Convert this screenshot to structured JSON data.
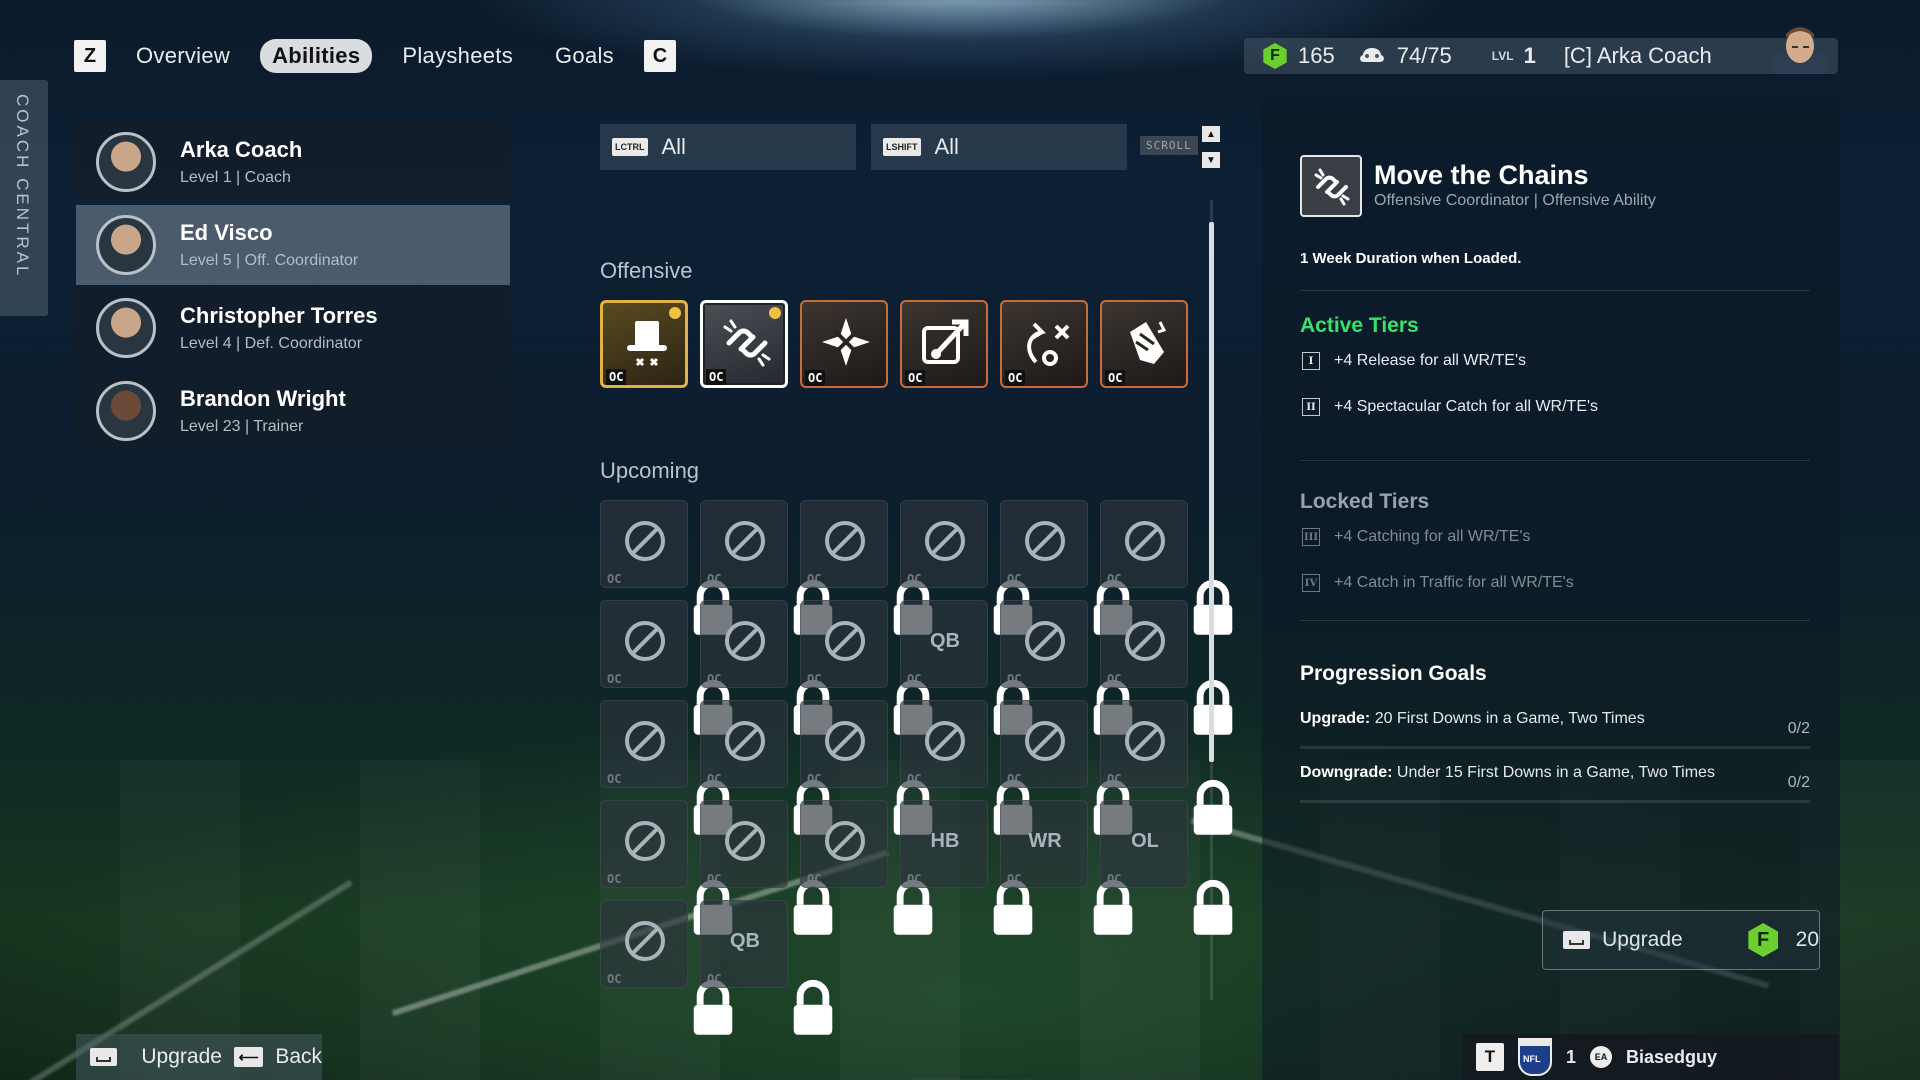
{
  "nav": {
    "left_key": "Z",
    "tabs": [
      "Overview",
      "Abilities",
      "Playsheets",
      "Goals"
    ],
    "active_tab": "Abilities",
    "right_key": "C"
  },
  "status": {
    "coins": "165",
    "capacity": "74/75",
    "lvl_label": "LVL",
    "lvl": "1",
    "coach_name": "[C] Arka Coach"
  },
  "sidetab": "COACH CENTRAL",
  "coaches": [
    {
      "name": "Arka Coach",
      "sub": "Level 1 | Coach",
      "selected": false
    },
    {
      "name": "Ed Visco",
      "sub": "Level 5 | Off. Coordinator",
      "selected": true
    },
    {
      "name": "Christopher Torres",
      "sub": "Level 4 | Def. Coordinator",
      "selected": false
    },
    {
      "name": "Brandon Wright",
      "sub": "Level 23 | Trainer",
      "selected": false
    }
  ],
  "filters": {
    "left_key": "LCTRL",
    "left_value": "All",
    "right_key": "LSHIFT",
    "right_value": "All",
    "scroll_label": "SCROLL"
  },
  "sections": {
    "offensive": "Offensive",
    "upcoming": "Upcoming"
  },
  "ability_tag": "OC",
  "offensive_abilities": [
    {
      "icon": "top-hat-icon",
      "style": "gold",
      "new": true
    },
    {
      "icon": "chain-link-icon",
      "style": "selected",
      "new": true
    },
    {
      "icon": "burst-arrows-icon",
      "style": "unlocked",
      "new": false
    },
    {
      "icon": "route-arrow-icon",
      "style": "unlocked",
      "new": false
    },
    {
      "icon": "play-route-icon",
      "style": "unlocked",
      "new": false
    },
    {
      "icon": "catch-hand-icon",
      "style": "unlocked",
      "new": false
    }
  ],
  "upcoming_abilities": [
    "football-speed-icon",
    "wall-arrow-icon",
    "waves-icon",
    "chain-up-icon",
    "route-bars-icon",
    "snowflake-icon",
    "lotus-icon",
    "xo-play-icon",
    "burst-arrow-icon",
    "qb-play-icon",
    "blocking-icon",
    "compress-icon",
    "target-icon",
    "crosshair-icon",
    "horse-icon",
    "fist-shield-icon",
    "xo-grid-icon",
    "formation-icon",
    "eye-icon",
    "magnet-icon",
    "star-badge-icon",
    "hb-text-icon",
    "wrte-text-icon",
    "ol-text-icon",
    "helmet-icon",
    "qb-text-icon"
  ],
  "detail": {
    "title": "Move the Chains",
    "subtitle": "Offensive Coordinator | Offensive Ability",
    "duration": "1 Week Duration when Loaded.",
    "active_heading": "Active Tiers",
    "active_tiers": [
      {
        "roman": "I",
        "text": "+4 Release for all WR/TE's"
      },
      {
        "roman": "II",
        "text": "+4 Spectacular Catch for all WR/TE's"
      }
    ],
    "locked_heading": "Locked Tiers",
    "locked_tiers": [
      {
        "roman": "III",
        "text": "+4 Catching for all WR/TE's"
      },
      {
        "roman": "IV",
        "text": "+4 Catch in Traffic for all WR/TE's"
      }
    ],
    "progression_heading": "Progression Goals",
    "goals": [
      {
        "label": "Upgrade:",
        "text": "20 First Downs in a Game, Two Times",
        "count": "0/2"
      },
      {
        "label": "Downgrade:",
        "text": "Under 15 First Downs in a Game, Two Times",
        "count": "0/2"
      }
    ],
    "upgrade_label": "Upgrade",
    "upgrade_cost": "20"
  },
  "bottom": {
    "upgrade_label": "Upgrade",
    "back_label": "Back",
    "key_t": "T",
    "player_level": "1",
    "gamertag": "Biasedguy"
  },
  "colors": {
    "accent_green": "#36e26a",
    "coin_green": "#6bd02f",
    "ability_orange": "#c96c3c",
    "ability_gold": "#e2b344"
  }
}
